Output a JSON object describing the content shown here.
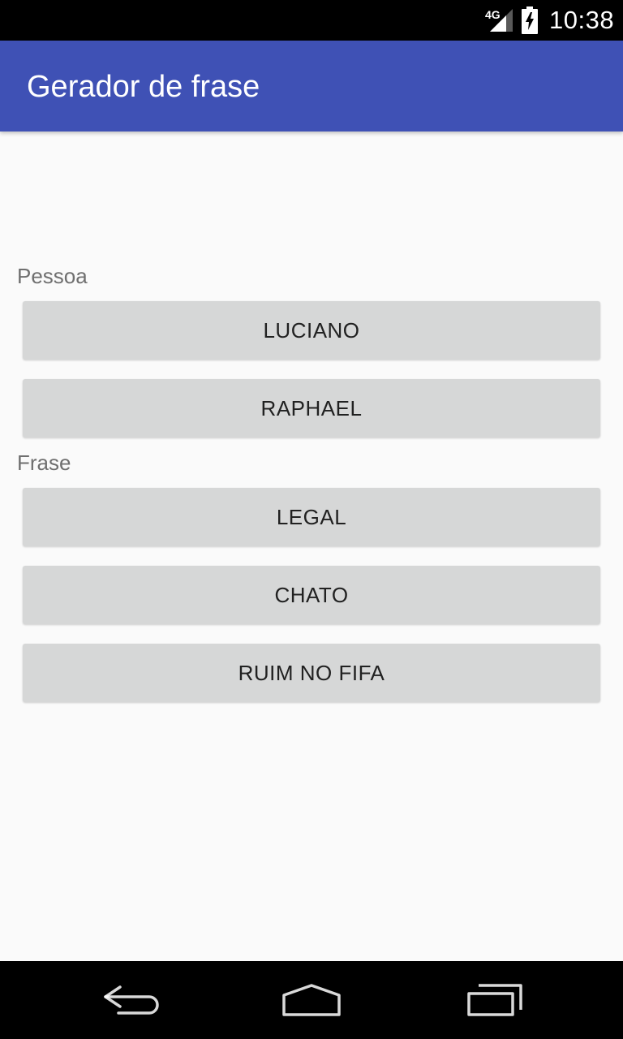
{
  "status_bar": {
    "network": "4G",
    "time": "10:38",
    "icons": [
      "signal-icon",
      "battery-charging-icon"
    ]
  },
  "app_bar": {
    "title": "Gerador de frase"
  },
  "pessoa": {
    "label": "Pessoa",
    "buttons": [
      "LUCIANO",
      "RAPHAEL"
    ]
  },
  "frase": {
    "label": "Frase",
    "buttons": [
      "LEGAL",
      "CHATO",
      "RUIM NO FIFA"
    ]
  },
  "nav_bar": {
    "icons": [
      "back-icon",
      "home-icon",
      "recent-apps-icon"
    ]
  },
  "colors": {
    "app_bar": "#3f51b5",
    "background": "#fafafa",
    "button": "#d6d7d7",
    "label": "#6f6f6f"
  }
}
